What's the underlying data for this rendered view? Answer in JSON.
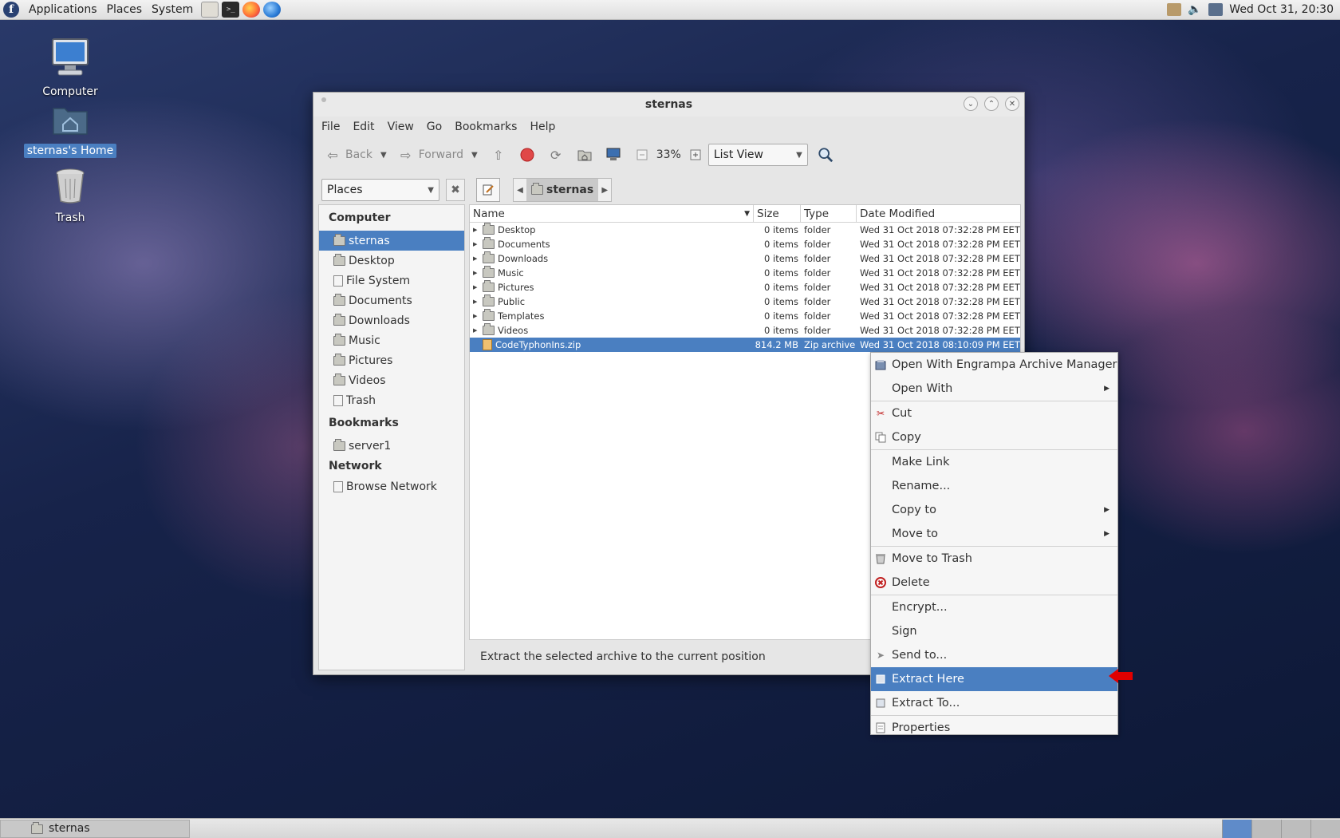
{
  "top_panel": {
    "menus": [
      "Applications",
      "Places",
      "System"
    ],
    "clock": "Wed Oct 31, 20:30"
  },
  "desktop_icons": [
    {
      "label": "Computer"
    },
    {
      "label": "sternas's Home"
    },
    {
      "label": "Trash"
    }
  ],
  "window": {
    "title": "sternas",
    "menu": [
      "File",
      "Edit",
      "View",
      "Go",
      "Bookmarks",
      "Help"
    ],
    "toolbar": {
      "back": "Back",
      "forward": "Forward",
      "zoom": "33%",
      "view_mode": "List View"
    },
    "side_pane_selector": "Places",
    "breadcrumb": "sternas",
    "sidebar": {
      "computer_heading": "Computer",
      "computer_items": [
        "sternas",
        "Desktop",
        "File System",
        "Documents",
        "Downloads",
        "Music",
        "Pictures",
        "Videos",
        "Trash"
      ],
      "bookmarks_heading": "Bookmarks",
      "bookmark_items": [
        "server1"
      ],
      "network_heading": "Network",
      "network_items": [
        "Browse Network"
      ]
    },
    "columns": {
      "name": "Name",
      "size": "Size",
      "type": "Type",
      "date": "Date Modified"
    },
    "files": [
      {
        "name": "Desktop",
        "size": "0 items",
        "type": "folder",
        "date": "Wed 31 Oct 2018 07:32:28 PM EET"
      },
      {
        "name": "Documents",
        "size": "0 items",
        "type": "folder",
        "date": "Wed 31 Oct 2018 07:32:28 PM EET"
      },
      {
        "name": "Downloads",
        "size": "0 items",
        "type": "folder",
        "date": "Wed 31 Oct 2018 07:32:28 PM EET"
      },
      {
        "name": "Music",
        "size": "0 items",
        "type": "folder",
        "date": "Wed 31 Oct 2018 07:32:28 PM EET"
      },
      {
        "name": "Pictures",
        "size": "0 items",
        "type": "folder",
        "date": "Wed 31 Oct 2018 07:32:28 PM EET"
      },
      {
        "name": "Public",
        "size": "0 items",
        "type": "folder",
        "date": "Wed 31 Oct 2018 07:32:28 PM EET"
      },
      {
        "name": "Templates",
        "size": "0 items",
        "type": "folder",
        "date": "Wed 31 Oct 2018 07:32:28 PM EET"
      },
      {
        "name": "Videos",
        "size": "0 items",
        "type": "folder",
        "date": "Wed 31 Oct 2018 07:32:28 PM EET"
      },
      {
        "name": "CodeTyphonIns.zip",
        "size": "814.2 MB",
        "type": "Zip archive",
        "date": "Wed 31 Oct 2018 08:10:09 PM EET"
      }
    ],
    "status": "Extract the selected archive to the current position"
  },
  "context_menu": {
    "open_with_app": "Open With Engrampa Archive Manager",
    "open_with": "Open With",
    "cut": "Cut",
    "copy": "Copy",
    "make_link": "Make Link",
    "rename": "Rename...",
    "copy_to": "Copy to",
    "move_to": "Move to",
    "move_to_trash": "Move to Trash",
    "delete": "Delete",
    "encrypt": "Encrypt...",
    "sign": "Sign",
    "send_to": "Send to...",
    "extract_here": "Extract Here",
    "extract_to": "Extract To...",
    "properties": "Properties"
  },
  "taskbar": {
    "task": "sternas"
  },
  "colors": {
    "selection": "#4a7fc1",
    "arrow": "#e00000"
  }
}
